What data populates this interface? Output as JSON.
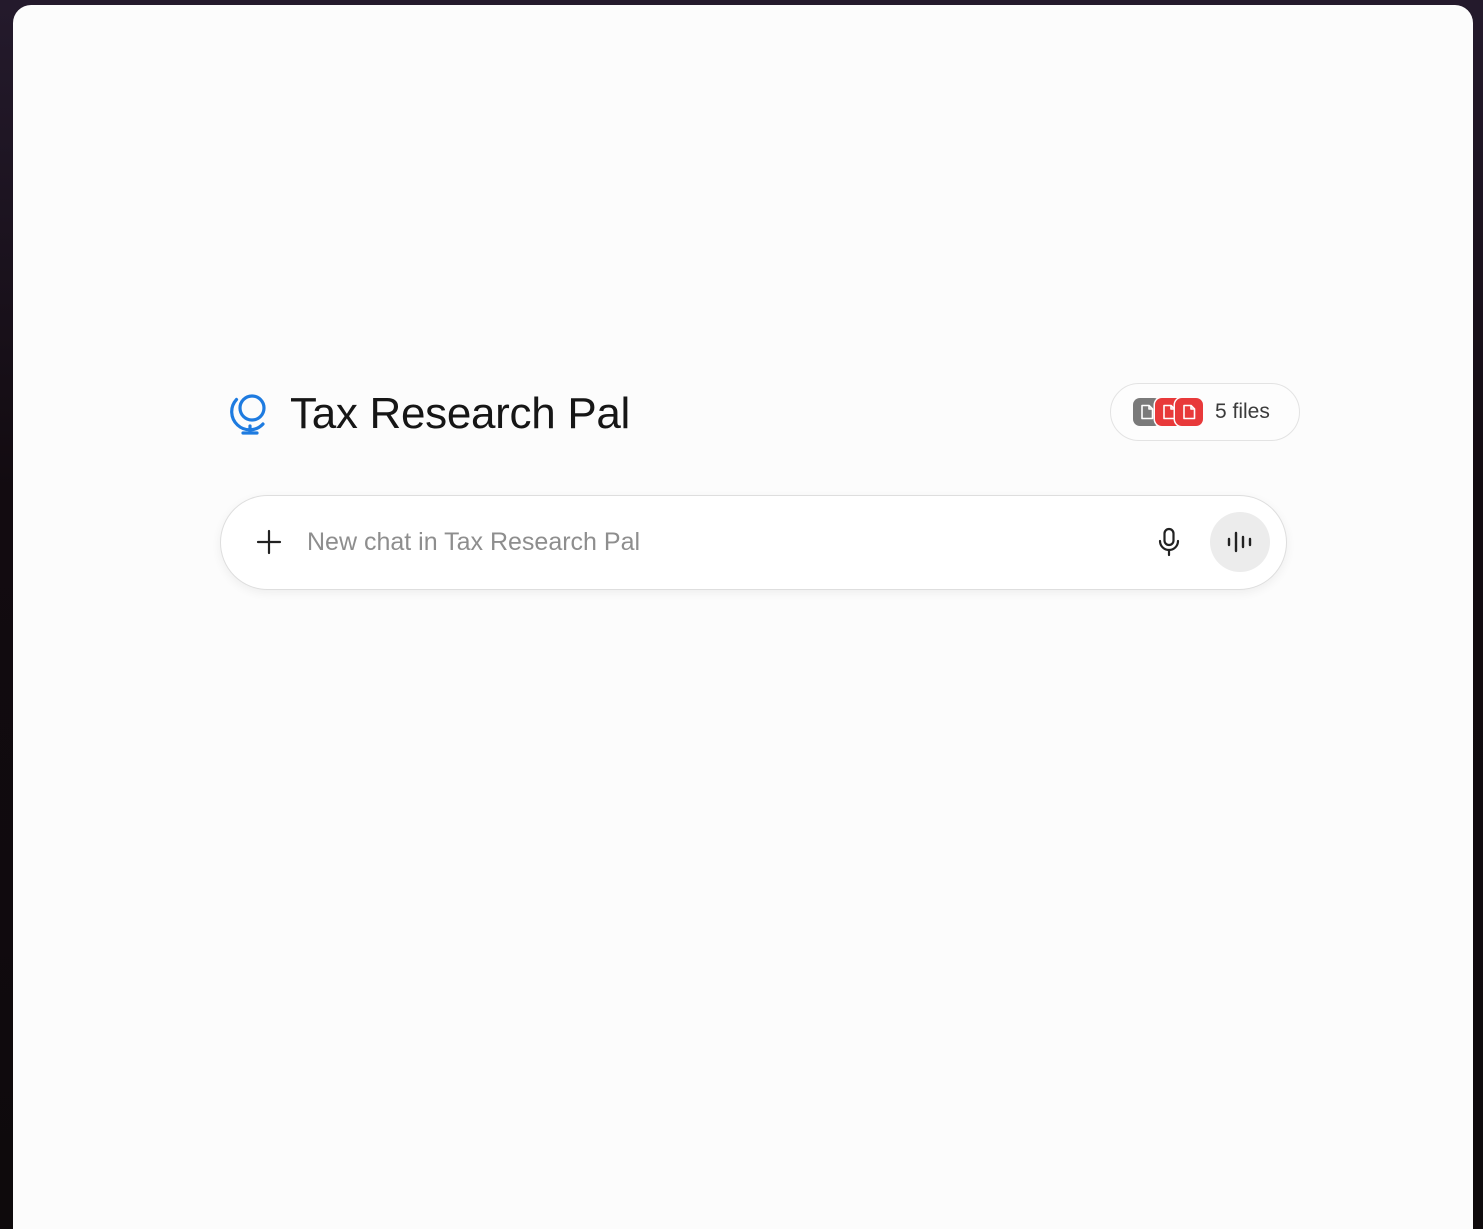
{
  "project": {
    "title": "Tax Research Pal",
    "icon": "globe-icon",
    "accent_color": "#1e7be0"
  },
  "files": {
    "label": "5 files",
    "count": 5,
    "chip_icons": [
      "document-icon",
      "pdf-icon",
      "pdf-icon"
    ],
    "chip_colors": [
      "#7a7a7a",
      "#e8393a",
      "#e8393a"
    ]
  },
  "composer": {
    "placeholder": "New chat in Tax Research Pal",
    "value": "",
    "plus_icon": "plus-icon",
    "mic_icon": "microphone-icon",
    "voice_icon": "voice-mode-icon"
  }
}
